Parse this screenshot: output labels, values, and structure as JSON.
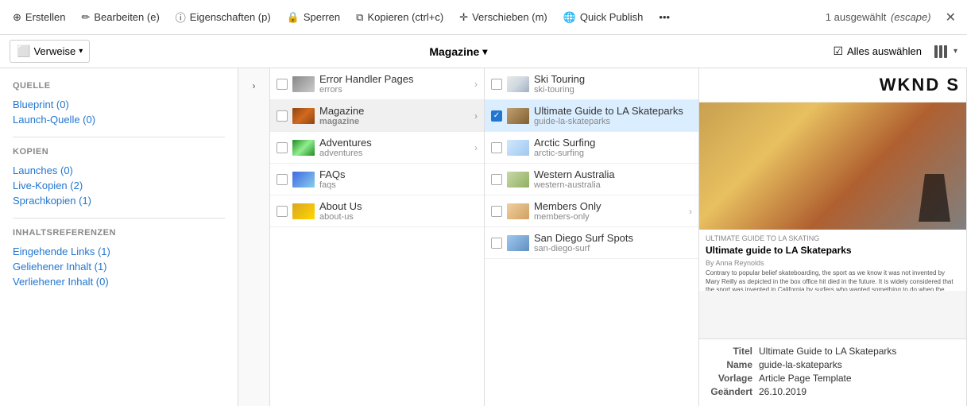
{
  "toolbar": {
    "erstellen_label": "Erstellen",
    "bearbeiten_label": "Bearbeiten (e)",
    "eigenschaften_label": "Eigenschaften (p)",
    "sperren_label": "Sperren",
    "kopieren_label": "Kopieren (ctrl+c)",
    "verschieben_label": "Verschieben (m)",
    "quickpublish_label": "Quick Publish",
    "more_label": "•••",
    "selected_label": "1 ausgewählt",
    "escape_label": "(escape)"
  },
  "secondbar": {
    "verweise_label": "Verweise",
    "magazine_label": "Magazine",
    "alles_label": "Alles auswählen"
  },
  "sidebar": {
    "quelle_title": "QUELLE",
    "kopien_title": "KOPIEN",
    "inhaltsreferenzen_title": "INHALTSREFERENZEN",
    "links": [
      {
        "label": "Blueprint (0)"
      },
      {
        "label": "Launch-Quelle (0)"
      },
      {
        "label": "Launches (0)"
      },
      {
        "label": "Live-Kopien (2)"
      },
      {
        "label": "Sprachkopien (1)"
      },
      {
        "label": "Eingehende Links (1)"
      },
      {
        "label": "Geliehener Inhalt (1)"
      },
      {
        "label": "Verliehener Inhalt (0)"
      }
    ]
  },
  "list1": {
    "items": [
      {
        "name": "Error Handler Pages",
        "slug": "errors",
        "has_arrow": true,
        "selected": false,
        "thumb_class": "errors-thumb"
      },
      {
        "name": "Magazine",
        "slug": "magazine",
        "has_arrow": true,
        "selected": false,
        "thumb_class": "magazine-thumb"
      },
      {
        "name": "Adventures",
        "slug": "adventures",
        "has_arrow": true,
        "selected": false,
        "thumb_class": "adventures-thumb"
      },
      {
        "name": "FAQs",
        "slug": "faqs",
        "has_arrow": false,
        "selected": false,
        "thumb_class": "faqs-thumb"
      },
      {
        "name": "About Us",
        "slug": "about-us",
        "has_arrow": false,
        "selected": false,
        "thumb_class": "about-thumb"
      }
    ]
  },
  "list2": {
    "items": [
      {
        "name": "Ski Touring",
        "slug": "ski-touring",
        "has_arrow": false,
        "selected": false,
        "checked": false,
        "thumb_class": "thumb-ski"
      },
      {
        "name": "Ultimate Guide to LA Skateparks",
        "slug": "guide-la-skateparks",
        "has_arrow": false,
        "selected": true,
        "checked": true,
        "thumb_class": "thumb-skateparks"
      },
      {
        "name": "Arctic Surfing",
        "slug": "arctic-surfing",
        "has_arrow": false,
        "selected": false,
        "checked": false,
        "thumb_class": "thumb-arctic"
      },
      {
        "name": "Western Australia",
        "slug": "western-australia",
        "has_arrow": false,
        "selected": false,
        "checked": false,
        "thumb_class": "thumb-western"
      },
      {
        "name": "Members Only",
        "slug": "members-only",
        "has_arrow": true,
        "selected": false,
        "checked": false,
        "thumb_class": "thumb-members"
      },
      {
        "name": "San Diego Surf Spots",
        "slug": "san-diego-surf",
        "has_arrow": false,
        "selected": false,
        "checked": false,
        "thumb_class": "thumb-sandiego"
      }
    ]
  },
  "preview": {
    "wknd": "WKND S",
    "breadcrumb": "ULTIMATE GUIDE TO LA SKATING",
    "title": "Ultimate guide to LA Skateparks",
    "author": "By Anna Reynolds",
    "body": "Contrary to popular belief skateboarding, the sport as we know it was not invented by\nMary Reilly as depicted in the box office hit died in the future. It is widely considered\nthat the sport was invented in California by surfers who wanted something to do when\nthe waves were not \"hot\" or to use surfer terms when there were no waves in the\nearly 1950s. This was termed \"sidewalk surfing\" as a never-ending wave that surfers\ncould drop in on, unless it was raining. Los Angeles is long considered the epicenter of"
  },
  "info": {
    "titel_label": "Titel",
    "titel_value": "Ultimate Guide to LA Skateparks",
    "name_label": "Name",
    "name_value": "guide-la-skateparks",
    "vorlage_label": "Vorlage",
    "vorlage_value": "Article Page Template",
    "geaendert_label": "Geändert",
    "geaendert_value": "26.10.2019"
  }
}
